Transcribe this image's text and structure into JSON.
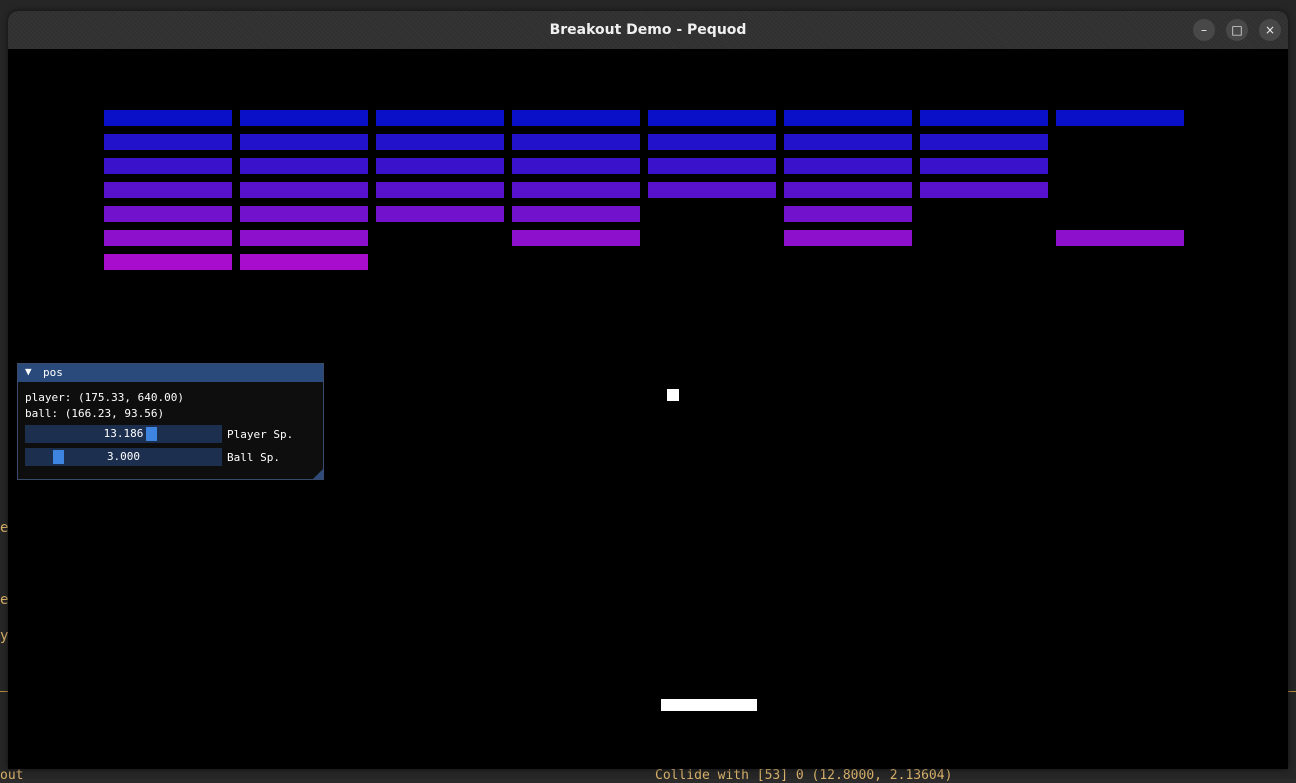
{
  "window": {
    "title": "Breakout Demo - Pequod",
    "controls": {
      "minimize": "–",
      "maximize": "□",
      "close": "×"
    }
  },
  "background_terminal": {
    "fragments": [
      "e",
      "e",
      "y",
      "out",
      "Collide with [53] 0 (12.8000, 2.13604)"
    ]
  },
  "game": {
    "brick_colors": [
      "#0a10c8",
      "#2212cc",
      "#3b12cc",
      "#5812cc",
      "#7212cc",
      "#8c10cc",
      "#a80ccc"
    ],
    "brick_grid": [
      [
        1,
        1,
        1,
        1,
        1,
        1,
        1,
        1
      ],
      [
        1,
        1,
        1,
        1,
        1,
        1,
        1,
        0
      ],
      [
        1,
        1,
        1,
        1,
        1,
        1,
        1,
        0
      ],
      [
        1,
        1,
        1,
        1,
        1,
        1,
        1,
        0
      ],
      [
        1,
        1,
        1,
        1,
        0,
        1,
        0,
        0
      ],
      [
        1,
        1,
        0,
        1,
        0,
        1,
        0,
        1
      ],
      [
        1,
        1,
        0,
        0,
        0,
        0,
        0,
        0
      ]
    ]
  },
  "debug_panel": {
    "title": "pos",
    "collapse_icon": "▼",
    "player_pos": "player: (175.33, 640.00)",
    "ball_pos": "ball: (166.23, 93.56)",
    "player_speed": {
      "value_text": "13.186",
      "label": "Player Sp.",
      "fraction": 0.65
    },
    "ball_speed": {
      "value_text": "3.000",
      "label": "Ball Sp.",
      "fraction": 0.15
    }
  }
}
